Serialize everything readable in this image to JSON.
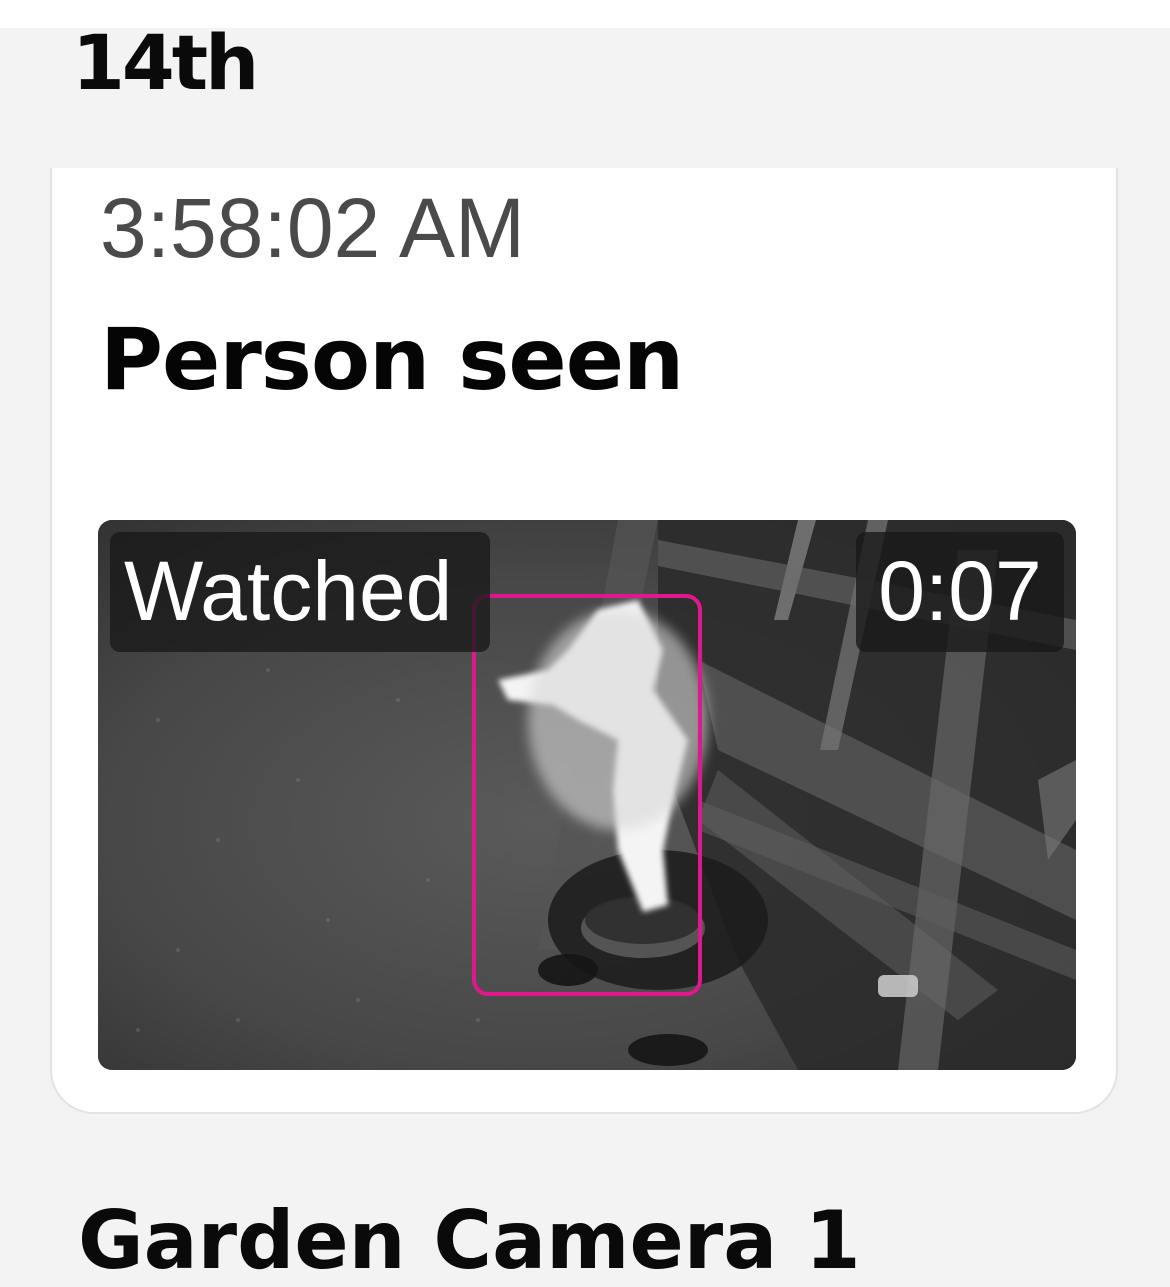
{
  "timeline": {
    "date_heading": "14th",
    "next_heading": "Garden Camera 1"
  },
  "event": {
    "time": "3:58:02 AM",
    "title": "Person seen",
    "video": {
      "watched_label": "Watched",
      "duration": "0:07",
      "detection_label": "person",
      "detection_color": "#e0188c"
    }
  },
  "colors": {
    "page_background": "#f3f3f3",
    "card_background": "#ffffff",
    "timestamp_text": "#4a4a4a",
    "title_text": "#050505"
  }
}
